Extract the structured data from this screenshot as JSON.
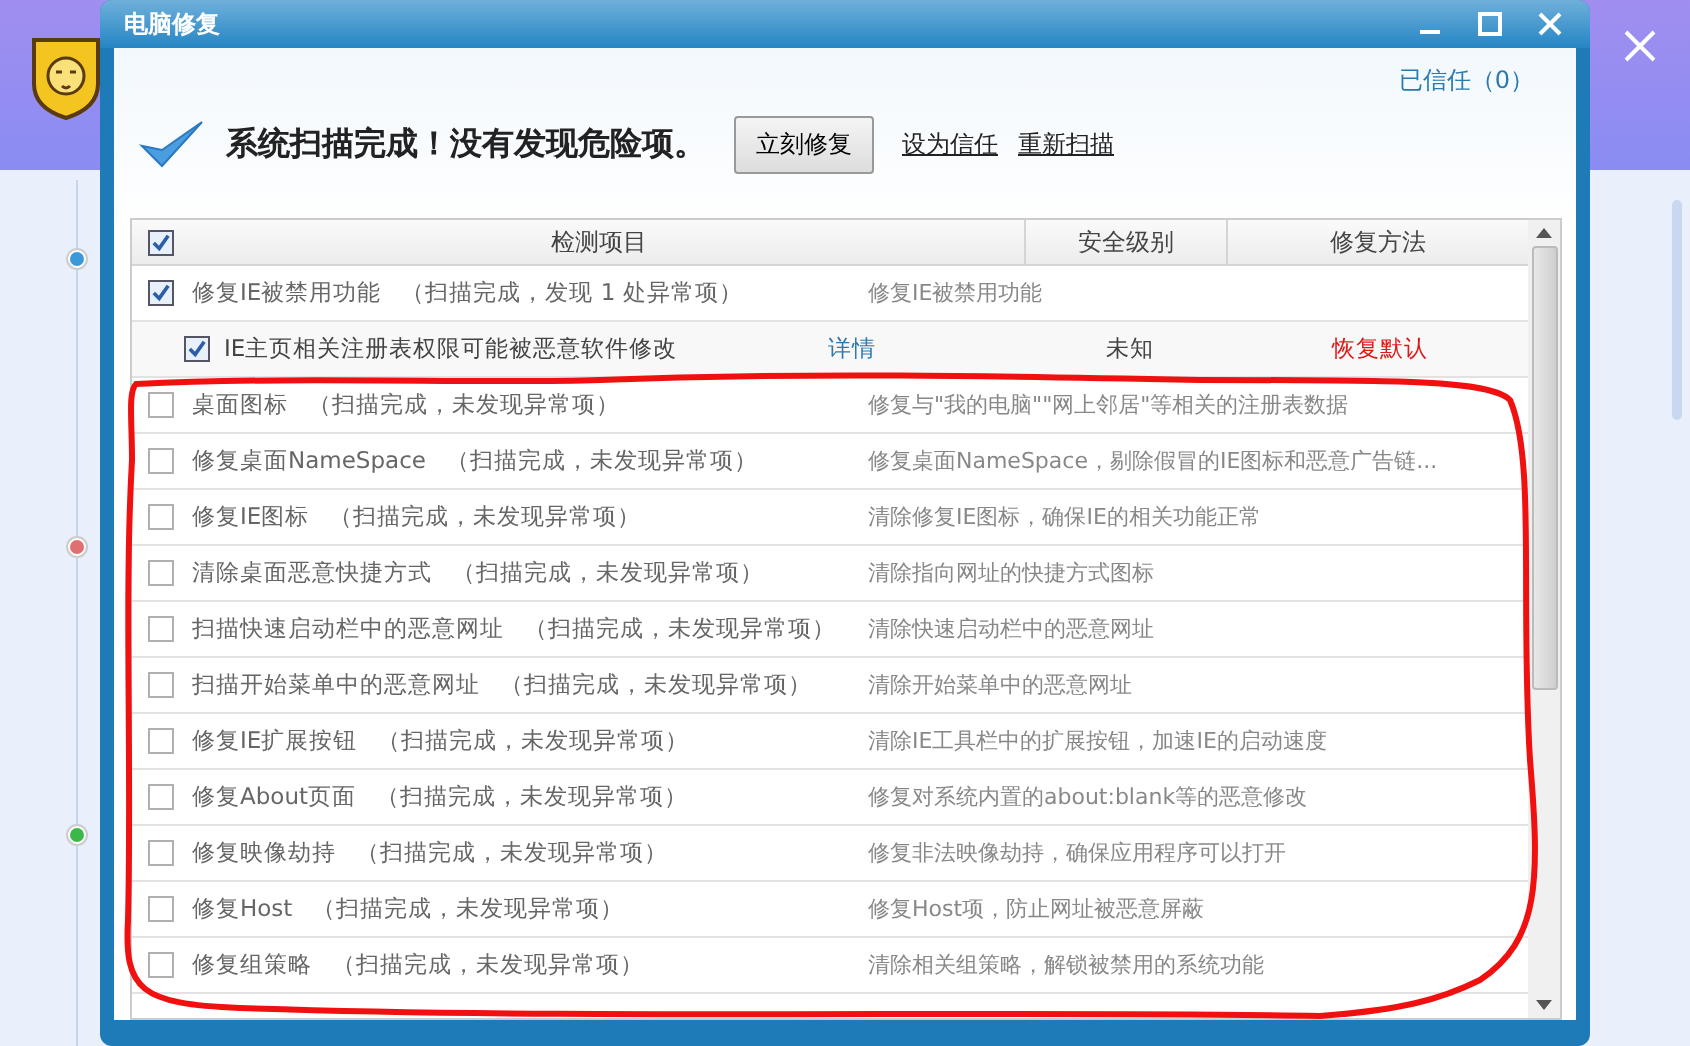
{
  "background_app": {
    "timeline_dots": [
      {
        "color": "#3a9ad9"
      },
      {
        "color": "#e07070"
      },
      {
        "color": "#3cb84a"
      }
    ]
  },
  "window": {
    "title": "电脑修复"
  },
  "trusted_link": "已信任（0）",
  "status": {
    "message": "系统扫描完成！没有发现危险项。",
    "fix_button": "立刻修复",
    "links": [
      "设为信任",
      "重新扫描"
    ]
  },
  "table": {
    "select_all_checked": true,
    "columns": [
      "检测项目",
      "安全级别",
      "修复方法"
    ],
    "rows": [
      {
        "kind": "item",
        "checked": true,
        "name": "修复IE被禁用功能",
        "status": "（扫描完成，发现 1 处异常项）",
        "description": "修复IE被禁用功能"
      },
      {
        "kind": "detail",
        "checked": true,
        "name": "IE主页相关注册表权限可能被恶意软件修改",
        "link": "详情",
        "level": "未知",
        "method": "恢复默认"
      },
      {
        "kind": "item",
        "checked": false,
        "name": "桌面图标",
        "status": "（扫描完成，未发现异常项）",
        "description": "修复与\"我的电脑\"\"网上邻居\"等相关的注册表数据"
      },
      {
        "kind": "item",
        "checked": false,
        "name": "修复桌面NameSpace",
        "status": "（扫描完成，未发现异常项）",
        "description": "修复桌面NameSpace，剔除假冒的IE图标和恶意广告链..."
      },
      {
        "kind": "item",
        "checked": false,
        "name": "修复IE图标",
        "status": "（扫描完成，未发现异常项）",
        "description": "清除修复IE图标，确保IE的相关功能正常"
      },
      {
        "kind": "item",
        "checked": false,
        "name": "清除桌面恶意快捷方式",
        "status": "（扫描完成，未发现异常项）",
        "description": "清除指向网址的快捷方式图标"
      },
      {
        "kind": "item",
        "checked": false,
        "name": "扫描快速启动栏中的恶意网址",
        "status": "（扫描完成，未发现异常项）",
        "description": "清除快速启动栏中的恶意网址"
      },
      {
        "kind": "item",
        "checked": false,
        "name": "扫描开始菜单中的恶意网址",
        "status": "（扫描完成，未发现异常项）",
        "description": "清除开始菜单中的恶意网址"
      },
      {
        "kind": "item",
        "checked": false,
        "name": "修复IE扩展按钮",
        "status": "（扫描完成，未发现异常项）",
        "description": "清除IE工具栏中的扩展按钮，加速IE的启动速度"
      },
      {
        "kind": "item",
        "checked": false,
        "name": "修复About页面",
        "status": "（扫描完成，未发现异常项）",
        "description": "修复对系统内置的about:blank等的恶意修改"
      },
      {
        "kind": "item",
        "checked": false,
        "name": "修复映像劫持",
        "status": "（扫描完成，未发现异常项）",
        "description": "修复非法映像劫持，确保应用程序可以打开"
      },
      {
        "kind": "item",
        "checked": false,
        "name": "修复Host",
        "status": "（扫描完成，未发现异常项）",
        "description": "修复Host项，防止网址被恶意屏蔽"
      },
      {
        "kind": "item",
        "checked": false,
        "name": "修复组策略",
        "status": "（扫描完成，未发现异常项）",
        "description": "清除相关组策略，解锁被禁用的系统功能"
      }
    ]
  }
}
